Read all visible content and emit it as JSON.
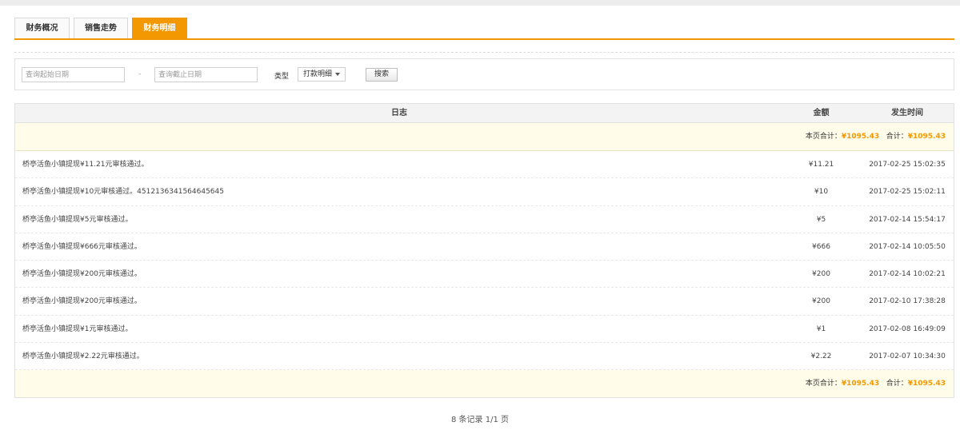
{
  "tabs": [
    "财务概况",
    "销售走势",
    "财务明细"
  ],
  "active_tab": 2,
  "filter": {
    "start_placeholder": "查询起始日期",
    "separator": "-",
    "end_placeholder": "查询截止日期",
    "type_label": "类型",
    "type_value": "打款明细",
    "search_label": "搜索"
  },
  "table": {
    "headers": {
      "log": "日志",
      "amount": "金额",
      "time": "发生时间"
    },
    "summary": {
      "page_total_label": "本页合计：",
      "page_total_value": "¥1095.43",
      "total_label": "合计：",
      "total_value": "¥1095.43"
    },
    "rows": [
      {
        "log": "桥亭活鱼小镇提现¥11.21元审核通过。",
        "amount": "¥11.21",
        "time": "2017-02-25 15:02:35"
      },
      {
        "log": "桥亭活鱼小镇提现¥10元审核通过。4512136341564645645",
        "amount": "¥10",
        "time": "2017-02-25 15:02:11"
      },
      {
        "log": "桥亭活鱼小镇提现¥5元审核通过。",
        "amount": "¥5",
        "time": "2017-02-14 15:54:17"
      },
      {
        "log": "桥亭活鱼小镇提现¥666元审核通过。",
        "amount": "¥666",
        "time": "2017-02-14 10:05:50"
      },
      {
        "log": "桥亭活鱼小镇提现¥200元审核通过。",
        "amount": "¥200",
        "time": "2017-02-14 10:02:21"
      },
      {
        "log": "桥亭活鱼小镇提现¥200元审核通过。",
        "amount": "¥200",
        "time": "2017-02-10 17:38:28"
      },
      {
        "log": "桥亭活鱼小镇提现¥1元审核通过。",
        "amount": "¥1",
        "time": "2017-02-08 16:49:09"
      },
      {
        "log": "桥亭活鱼小镇提现¥2.22元审核通过。",
        "amount": "¥2.22",
        "time": "2017-02-07 10:34:30"
      }
    ]
  },
  "pager": "8 条记录 1/1 页",
  "colors": {
    "accent": "#f39800",
    "summary_bg": "#fffdea"
  }
}
